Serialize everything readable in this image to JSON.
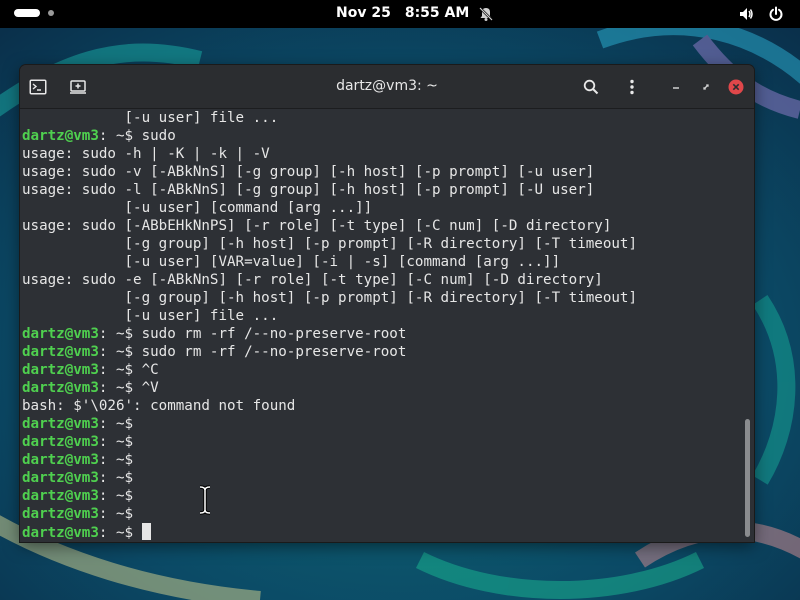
{
  "topbar": {
    "date": "Nov 25",
    "time": "8:55 AM"
  },
  "window": {
    "title": "dartz@vm3: ~"
  },
  "prompt": "dartz@vm3",
  "terminal_lines": [
    {
      "prompt": "",
      "text": "            [-u user] file ..."
    },
    {
      "prompt": "dartz@vm3",
      "text": ": ~$ sudo"
    },
    {
      "prompt": "",
      "text": "usage: sudo -h | -K | -k | -V"
    },
    {
      "prompt": "",
      "text": "usage: sudo -v [-ABkNnS] [-g group] [-h host] [-p prompt] [-u user]"
    },
    {
      "prompt": "",
      "text": "usage: sudo -l [-ABkNnS] [-g group] [-h host] [-p prompt] [-U user]"
    },
    {
      "prompt": "",
      "text": "            [-u user] [command [arg ...]]"
    },
    {
      "prompt": "",
      "text": "usage: sudo [-ABbEHkNnPS] [-r role] [-t type] [-C num] [-D directory]"
    },
    {
      "prompt": "",
      "text": "            [-g group] [-h host] [-p prompt] [-R directory] [-T timeout]"
    },
    {
      "prompt": "",
      "text": "            [-u user] [VAR=value] [-i | -s] [command [arg ...]]"
    },
    {
      "prompt": "",
      "text": "usage: sudo -e [-ABkNnS] [-r role] [-t type] [-C num] [-D directory]"
    },
    {
      "prompt": "",
      "text": "            [-g group] [-h host] [-p prompt] [-R directory] [-T timeout]"
    },
    {
      "prompt": "",
      "text": "            [-u user] file ..."
    },
    {
      "prompt": "dartz@vm3",
      "text": ": ~$ sudo rm -rf /--no-preserve-root"
    },
    {
      "prompt": "dartz@vm3",
      "text": ": ~$ sudo rm -rf /--no-preserve-root"
    },
    {
      "prompt": "dartz@vm3",
      "text": ": ~$ ^C"
    },
    {
      "prompt": "dartz@vm3",
      "text": ": ~$ ^V"
    },
    {
      "prompt": "",
      "text": "bash: $'\\026': command not found"
    },
    {
      "prompt": "dartz@vm3",
      "text": ": ~$"
    },
    {
      "prompt": "dartz@vm3",
      "text": ": ~$"
    },
    {
      "prompt": "dartz@vm3",
      "text": ": ~$"
    },
    {
      "prompt": "dartz@vm3",
      "text": ": ~$"
    },
    {
      "prompt": "dartz@vm3",
      "text": ": ~$"
    },
    {
      "prompt": "dartz@vm3",
      "text": ": ~$"
    },
    {
      "prompt": "dartz@vm3",
      "text": ": ~$ "
    }
  ],
  "icons": {
    "terminal": "terminal-icon",
    "new_tab": "new-tab-icon",
    "search": "search-icon",
    "menu": "kebab-menu-icon",
    "minimize": "minimize-icon",
    "restore": "restore-icon",
    "close": "close-icon",
    "volume": "volume-icon",
    "power": "power-icon",
    "bell": "notifications-muted-icon"
  },
  "colors": {
    "prompt": "#4fd04f",
    "close": "#e0474a",
    "terminal_bg": "#2d3035"
  }
}
